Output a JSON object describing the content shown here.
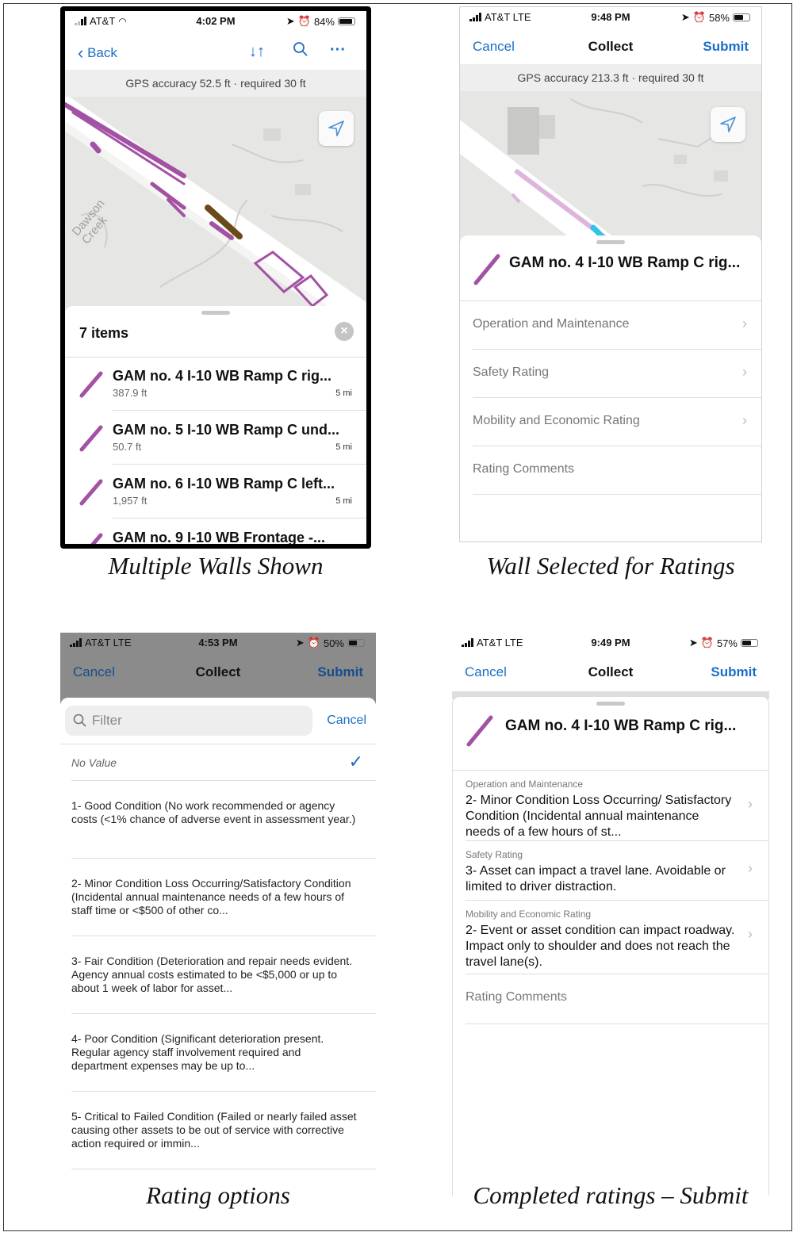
{
  "panels": {
    "p1": {
      "status": {
        "carrier": "AT&T",
        "time": "4:02 PM",
        "battery": "84%"
      },
      "nav": {
        "back": "Back"
      },
      "gps": "GPS accuracy 52.5 ft · required 30 ft",
      "map_label": "Dawson Creek",
      "list_count": "7 items",
      "items": [
        {
          "title": "GAM no. 4  I-10 WB Ramp C rig...",
          "length": "387.9 ft",
          "dist": "5 mi"
        },
        {
          "title": "GAM no. 5  I-10 WB Ramp C und...",
          "length": "50.7 ft",
          "dist": "5 mi"
        },
        {
          "title": "GAM no. 6  I-10 WB Ramp C left...",
          "length": "1,957 ft",
          "dist": "5 mi"
        },
        {
          "title": "GAM no. 9  I-10 WB Frontage -...",
          "length": "",
          "dist": ""
        }
      ],
      "caption": "Multiple Walls Shown"
    },
    "p2": {
      "status": {
        "carrier": "AT&T  LTE",
        "time": "9:48 PM",
        "battery": "58%"
      },
      "nav": {
        "cancel": "Cancel",
        "title": "Collect",
        "submit": "Submit"
      },
      "gps": "GPS accuracy 213.3 ft · required 30 ft",
      "feature_title": "GAM no. 4  I-10 WB Ramp C rig...",
      "fields": [
        "Operation and Maintenance",
        "Safety Rating",
        "Mobility and Economic Rating",
        "Rating Comments"
      ],
      "caption": "Wall Selected for Ratings"
    },
    "p3": {
      "status": {
        "carrier": "AT&T  LTE",
        "time": "4:53 PM",
        "battery": "50%"
      },
      "nav": {
        "cancel": "Cancel",
        "title": "Collect",
        "submit": "Submit"
      },
      "filter_placeholder": "Filter",
      "filter_cancel": "Cancel",
      "no_value": "No Value",
      "options": [
        "1- Good Condition (No work recommended or agency costs (<1% chance of adverse event in assessment year.)",
        "2- Minor Condition Loss Occurring/Satisfactory Condition (Incidental annual maintenance needs of a few hours of staff time or <$500 of other co...",
        "3- Fair Condition (Deterioration and repair needs evident. Agency annual costs estimated to be <$5,000 or up to about 1 week of labor for asset...",
        "4- Poor Condition (Significant deterioration present. Regular agency staff involvement required and department expenses may be up to...",
        "5- Critical to Failed Condition (Failed or nearly failed asset causing other assets to be out of service with corrective action required or immin..."
      ],
      "caption": "Rating options"
    },
    "p4": {
      "status": {
        "carrier": "AT&T  LTE",
        "time": "9:49 PM",
        "battery": "57%"
      },
      "nav": {
        "cancel": "Cancel",
        "title": "Collect",
        "submit": "Submit"
      },
      "feature_title": "GAM no. 4  I-10 WB Ramp C rig...",
      "ratings": [
        {
          "label": "Operation and Maintenance",
          "value": "2- Minor Condition Loss Occurring/ Satisfactory Condition (Incidental annual maintenance needs of a few hours of st..."
        },
        {
          "label": "Safety Rating",
          "value": "3- Asset can impact a travel lane. Avoidable or limited to driver distraction."
        },
        {
          "label": "Mobility and Economic Rating",
          "value": "2- Event or asset condition can impact roadway. Impact only to shoulder and does not reach the travel lane(s)."
        }
      ],
      "comments_label": "Rating Comments",
      "caption": "Completed ratings – Submit"
    }
  },
  "colors": {
    "accent": "#1a6ec8",
    "feature": "#a352a3",
    "selected": "#6b4a1a",
    "highlight": "#2fc4e8"
  }
}
